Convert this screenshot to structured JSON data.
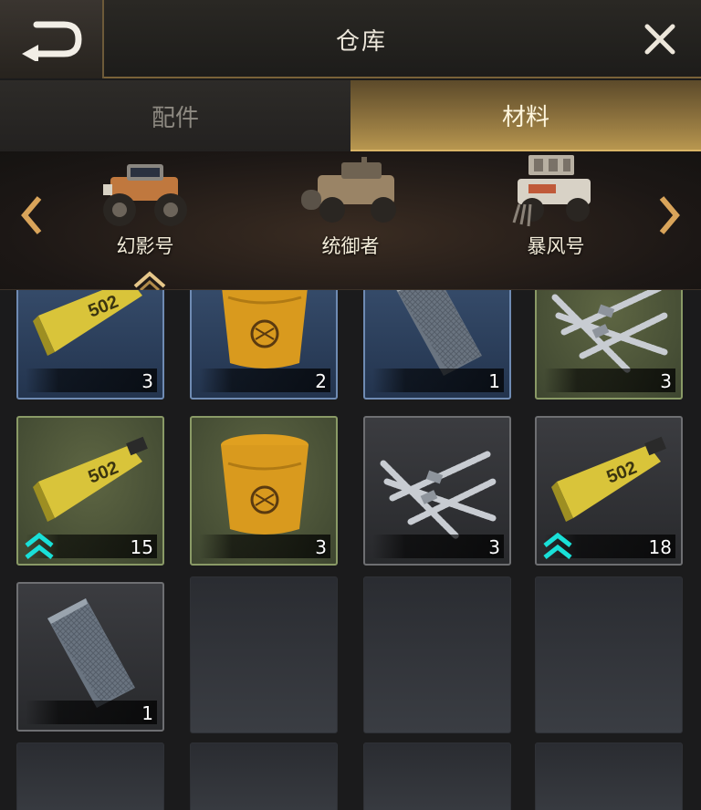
{
  "header": {
    "title": "仓库",
    "back_icon": "back-arrow-icon",
    "close_icon": "close-icon"
  },
  "tabs": [
    {
      "label": "配件",
      "active": false
    },
    {
      "label": "材料",
      "active": true
    }
  ],
  "vehicles": [
    {
      "name": "幻影号",
      "selected": true
    },
    {
      "name": "统御者",
      "selected": false
    },
    {
      "name": "暴风号",
      "selected": false
    }
  ],
  "items": [
    {
      "kind": "glue",
      "rarity": "blue",
      "qty": "3",
      "upgrade": false
    },
    {
      "kind": "bucket",
      "rarity": "blue",
      "qty": "2",
      "upgrade": false
    },
    {
      "kind": "sheet",
      "rarity": "blue",
      "qty": "1",
      "upgrade": false
    },
    {
      "kind": "rebar",
      "rarity": "green",
      "qty": "3",
      "upgrade": false
    },
    {
      "kind": "glue",
      "rarity": "green",
      "qty": "15",
      "upgrade": true
    },
    {
      "kind": "bucket",
      "rarity": "green",
      "qty": "3",
      "upgrade": false
    },
    {
      "kind": "rebar",
      "rarity": "gray",
      "qty": "3",
      "upgrade": false
    },
    {
      "kind": "glue",
      "rarity": "gray",
      "qty": "18",
      "upgrade": true
    },
    {
      "kind": "sheet",
      "rarity": "gray",
      "qty": "1",
      "upgrade": false
    }
  ],
  "glue_label": "502",
  "colors": {
    "accent_gold": "#b8974f",
    "rarity_blue": "#6f8bb3",
    "rarity_green": "#8a9a66",
    "rarity_gray": "#6e6f72",
    "upgrade_cyan": "#19e0d8"
  }
}
